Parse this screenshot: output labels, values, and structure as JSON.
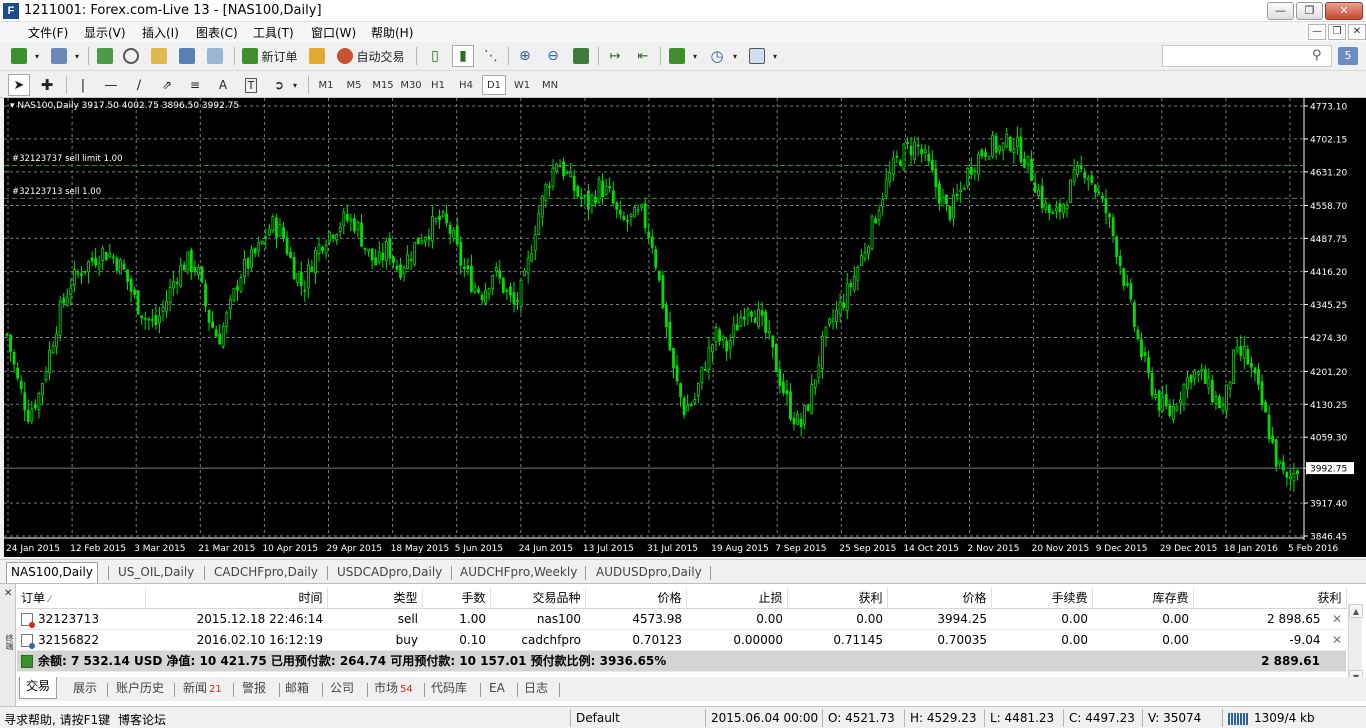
{
  "window": {
    "title": "1211001: Forex.com-Live 13 - [NAS100,Daily]",
    "buttons": [
      "minimize",
      "restore",
      "close"
    ]
  },
  "menu": [
    "文件(F)",
    "显示(V)",
    "插入(I)",
    "图表(C)",
    "工具(T)",
    "窗口(W)",
    "帮助(H)"
  ],
  "toolbar": {
    "new_order": "新订单",
    "auto_trading": "自动交易",
    "timeframes": [
      "M1",
      "M5",
      "M15",
      "M30",
      "H1",
      "H4",
      "D1",
      "W1",
      "MN"
    ],
    "active_timeframe": "D1",
    "search_placeholder": ""
  },
  "chart": {
    "symbol_info": "NAS100,Daily  3917.50 4002.75 3896.50 3992.75",
    "orders": [
      {
        "label": "#32123737 sell limit 1.00",
        "price": 4645.0
      },
      {
        "label": "#32123713 sell 1.00",
        "price": 4573.98
      }
    ],
    "current_price": "3992.75",
    "colors": {
      "background": "#000000",
      "candles": "#00e000",
      "grid": "#7a7a7a",
      "text": "#ffffff"
    }
  },
  "chart_data": {
    "type": "candlestick",
    "title": "NAS100,Daily",
    "ohlc_last": {
      "open": 3917.5,
      "high": 4002.75,
      "low": 3896.5,
      "close": 3992.75
    },
    "ylim": [
      3846.45,
      4773.1
    ],
    "y_ticks": [
      "4773.10",
      "4702.15",
      "4631.20",
      "4558.70",
      "4487.75",
      "4416.20",
      "4345.25",
      "4274.30",
      "4201.20",
      "4130.25",
      "4059.30",
      "3992.75",
      "3917.40",
      "3846.45"
    ],
    "x_ticks": [
      "24 Jan 2015",
      "12 Feb 2015",
      "3 Mar 2015",
      "21 Mar 2015",
      "10 Apr 2015",
      "29 Apr 2015",
      "18 May 2015",
      "5 Jun 2015",
      "24 Jun 2015",
      "13 Jul 2015",
      "31 Jul 2015",
      "19 Aug 2015",
      "7 Sep 2015",
      "25 Sep 2015",
      "14 Oct 2015",
      "2 Nov 2015",
      "20 Nov 2015",
      "9 Dec 2015",
      "29 Dec 2015",
      "18 Jan 2016",
      "5 Feb 2016"
    ],
    "close_path": [
      4280,
      4180,
      4110,
      4150,
      4240,
      4330,
      4390,
      4420,
      4440,
      4460,
      4450,
      4420,
      4360,
      4320,
      4300,
      4350,
      4410,
      4440,
      4420,
      4320,
      4270,
      4330,
      4410,
      4440,
      4470,
      4520,
      4500,
      4430,
      4380,
      4450,
      4490,
      4510,
      4530,
      4520,
      4460,
      4430,
      4470,
      4420,
      4450,
      4490,
      4510,
      4530,
      4500,
      4430,
      4390,
      4370,
      4420,
      4380,
      4340,
      4400,
      4520,
      4600,
      4660,
      4620,
      4580,
      4560,
      4600,
      4580,
      4520,
      4530,
      4540,
      4480,
      4350,
      4200,
      4120,
      4140,
      4220,
      4280,
      4250,
      4300,
      4350,
      4320,
      4270,
      4190,
      4120,
      4080,
      4150,
      4250,
      4310,
      4350,
      4400,
      4460,
      4530,
      4600,
      4650,
      4680,
      4690,
      4650,
      4590,
      4540,
      4580,
      4640,
      4670,
      4690,
      4680,
      4700,
      4670,
      4620,
      4560,
      4530,
      4570,
      4620,
      4640,
      4590,
      4540,
      4460,
      4360,
      4260,
      4180,
      4130,
      4110,
      4160,
      4200,
      4190,
      4150,
      4120,
      4230,
      4240,
      4180,
      4100,
      4010,
      3960,
      3993
    ]
  },
  "chart_tabs": [
    "NAS100,Daily",
    "US_OIL,Daily",
    "CADCHFpro,Daily",
    "USDCADpro,Daily",
    "AUDCHFpro,Weekly",
    "AUDUSDpro,Daily"
  ],
  "terminal": {
    "side_label": "终端",
    "columns": [
      "订单",
      "时间",
      "类型",
      "手数",
      "交易品种",
      "价格",
      "止损",
      "获利",
      "价格",
      "手续费",
      "库存费",
      "获利"
    ],
    "rows": [
      {
        "order": "32123713",
        "time": "2015.12.18 22:46:14",
        "type": "sell",
        "lots": "1.00",
        "symbol": "nas100",
        "price": "4573.98",
        "sl": "0.00",
        "tp": "0.00",
        "cur_price": "3994.25",
        "commission": "0.00",
        "swap": "0.00",
        "profit": "2 898.65"
      },
      {
        "order": "32156822",
        "time": "2016.02.10 16:12:19",
        "type": "buy",
        "lots": "0.10",
        "symbol": "cadchfpro",
        "price": "0.70123",
        "sl": "0.00000",
        "tp": "0.71145",
        "cur_price": "0.70035",
        "commission": "0.00",
        "swap": "0.00",
        "profit": "-9.04"
      }
    ],
    "summary": {
      "text": "余额: 7 532.14 USD  净值: 10 421.75  已用预付款: 264.74  可用预付款: 10 157.01  预付款比例: 3936.65%",
      "total": "2 889.61"
    },
    "tabs": [
      {
        "label": "交易",
        "count": ""
      },
      {
        "label": "展示",
        "count": ""
      },
      {
        "label": "账户历史",
        "count": ""
      },
      {
        "label": "新闻",
        "count": "21"
      },
      {
        "label": "警报",
        "count": ""
      },
      {
        "label": "邮箱",
        "count": ""
      },
      {
        "label": "公司",
        "count": ""
      },
      {
        "label": "市场",
        "count": "54"
      },
      {
        "label": "代码库",
        "count": ""
      },
      {
        "label": "EA",
        "count": ""
      },
      {
        "label": "日志",
        "count": ""
      }
    ]
  },
  "statusbar": {
    "help": "寻求帮助, 请按F1键",
    "forum": "博客论坛",
    "profile": "Default",
    "datetime": "2015.06.04 00:00",
    "open": "O: 4521.73",
    "high": "H: 4529.23",
    "low": "L: 4481.23",
    "close": "C: 4497.23",
    "volume": "V: 35074",
    "traffic": "1309/4 kb"
  }
}
